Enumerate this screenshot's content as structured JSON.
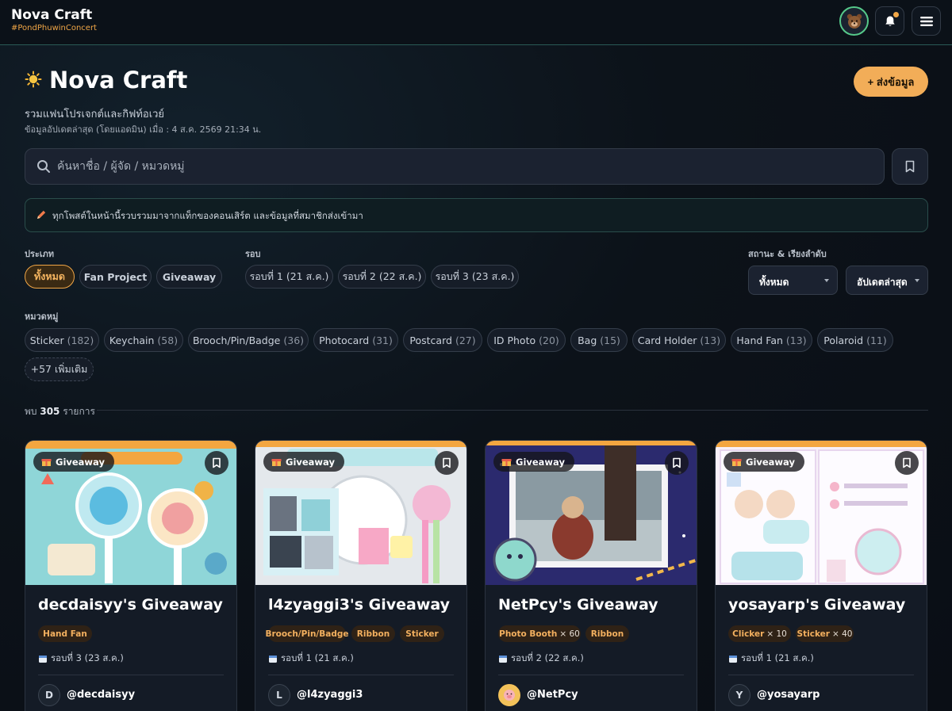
{
  "topbar": {
    "brand_title": "Nova Craft",
    "brand_tag": "#PondPhuwinConcert"
  },
  "header": {
    "title": "Nova Craft",
    "subtitle": "รวมแฟนโปรเจกต์และกิฟท์อเวย์",
    "updated": "ข้อมูลอัปเดตล่าสุด (โดยแอดมิน) เมื่อ : 4 ส.ค. 2569 21:34 น.",
    "submit_label": "+ ส่งข้อมูล"
  },
  "search": {
    "placeholder": "ค้นหาชื่อ / ผู้จัด / หมวดหมู่"
  },
  "notice": {
    "text": "ทุกโพสต์ในหน้านี้รวบรวมมาจากแท็กของคอนเสิร์ต และข้อมูลที่สมาชิกส่งเข้ามา"
  },
  "filters": {
    "type_label": "ประเภท",
    "types": [
      "ทั้งหมด",
      "Fan Project",
      "Giveaway"
    ],
    "round_label": "รอบ",
    "rounds": [
      "รอบที่ 1 (21 ส.ค.)",
      "รอบที่ 2 (22 ส.ค.)",
      "รอบที่ 3 (23 ส.ค.)"
    ],
    "status_label": "สถานะ & เรียงลำดับ",
    "status_value": "ทั้งหมด",
    "sort_value": "อัปเดตล่าสุด",
    "category_label": "หมวดหมู่",
    "categories": [
      {
        "name": "Sticker",
        "count": "(182)"
      },
      {
        "name": "Keychain",
        "count": "(58)"
      },
      {
        "name": "Brooch/Pin/Badge",
        "count": "(36)"
      },
      {
        "name": "Photocard",
        "count": "(31)"
      },
      {
        "name": "Postcard",
        "count": "(27)"
      },
      {
        "name": "ID Photo",
        "count": "(20)"
      },
      {
        "name": "Bag",
        "count": "(15)"
      },
      {
        "name": "Card Holder",
        "count": "(13)"
      },
      {
        "name": "Hand Fan",
        "count": "(13)"
      },
      {
        "name": "Polaroid",
        "count": "(11)"
      }
    ],
    "more_label": "+57 เพิ่มเติม"
  },
  "results": {
    "prefix": "พบ",
    "count": "305",
    "suffix": "รายการ"
  },
  "cards": [
    {
      "badge": "Giveaway",
      "title": "decdaisyy's Giveaway",
      "tags": [
        {
          "name": "Hand Fan",
          "qty": ""
        }
      ],
      "round": "รอบที่ 3 (23 ส.ค.)",
      "avatar": "D",
      "handle": "@decdaisyy"
    },
    {
      "badge": "Giveaway",
      "title": "l4zyaggi3's Giveaway",
      "tags": [
        {
          "name": "Brooch/Pin/Badge",
          "qty": ""
        },
        {
          "name": "Ribbon",
          "qty": ""
        },
        {
          "name": "Sticker",
          "qty": ""
        }
      ],
      "round": "รอบที่ 1 (21 ส.ค.)",
      "avatar": "L",
      "handle": "@l4zyaggi3"
    },
    {
      "badge": "Giveaway",
      "title": "NetPcy's Giveaway",
      "tags": [
        {
          "name": "Photo Booth",
          "qty": "× 60"
        },
        {
          "name": "Ribbon",
          "qty": ""
        }
      ],
      "round": "รอบที่ 2 (22 ส.ค.)",
      "avatar": "",
      "handle": "@NetPcy"
    },
    {
      "badge": "Giveaway",
      "title": "yosayarp's Giveaway",
      "tags": [
        {
          "name": "Clicker",
          "qty": "× 10"
        },
        {
          "name": "Sticker",
          "qty": "× 40"
        }
      ],
      "round": "รอบที่ 1 (21 ส.ค.)",
      "avatar": "Y",
      "handle": "@yosayarp"
    }
  ],
  "colors": {
    "accent": "#f2ad58",
    "background": "#0c1219",
    "card": "#141b26",
    "teal_border": "#2a5a56"
  },
  "icons": {
    "avatar": "bear-icon",
    "bell": "bell-icon",
    "menu": "menu-icon",
    "search": "search-icon",
    "bookmark": "bookmark-icon",
    "notice": "pencil-icon",
    "badge": "gift-icon",
    "round": "calendar-icon"
  }
}
